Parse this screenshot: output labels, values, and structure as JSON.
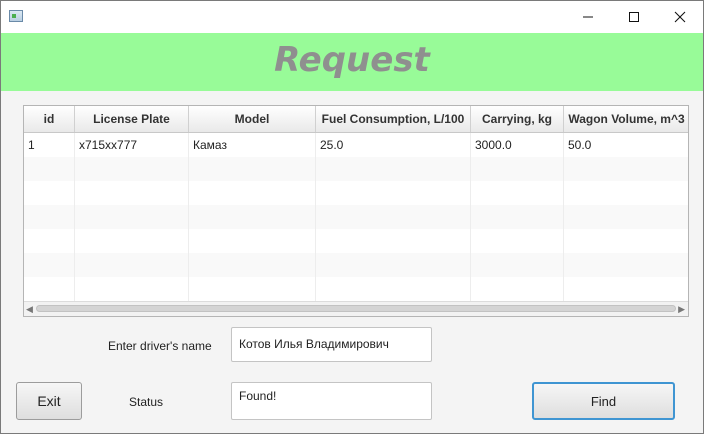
{
  "window": {
    "controls": {
      "minimize_icon": "minimize-icon",
      "maximize_icon": "maximize-icon",
      "close_icon": "close-icon"
    }
  },
  "header": {
    "title": "Request",
    "bg_color": "#98fb98",
    "title_color": "#8f8f8f"
  },
  "table": {
    "columns": [
      "id",
      "License Plate",
      "Model",
      "Fuel Consumption, L/100",
      "Carrying, kg",
      "Wagon Volume, m^3"
    ],
    "rows": [
      [
        "1",
        "x715xx777",
        "Камаз",
        "25.0",
        "3000.0",
        "50.0"
      ],
      [
        "",
        "",
        "",
        "",
        "",
        ""
      ],
      [
        "",
        "",
        "",
        "",
        "",
        ""
      ],
      [
        "",
        "",
        "",
        "",
        "",
        ""
      ],
      [
        "",
        "",
        "",
        "",
        "",
        ""
      ],
      [
        "",
        "",
        "",
        "",
        "",
        ""
      ],
      [
        "",
        "",
        "",
        "",
        "",
        ""
      ]
    ]
  },
  "form": {
    "driver_label": "Enter driver's name",
    "driver_value": "Котов Илья Владимирович",
    "status_label": "Status",
    "status_value": "Found!"
  },
  "buttons": {
    "exit": "Exit",
    "find": "Find",
    "accent_color": "#3f95d2"
  }
}
